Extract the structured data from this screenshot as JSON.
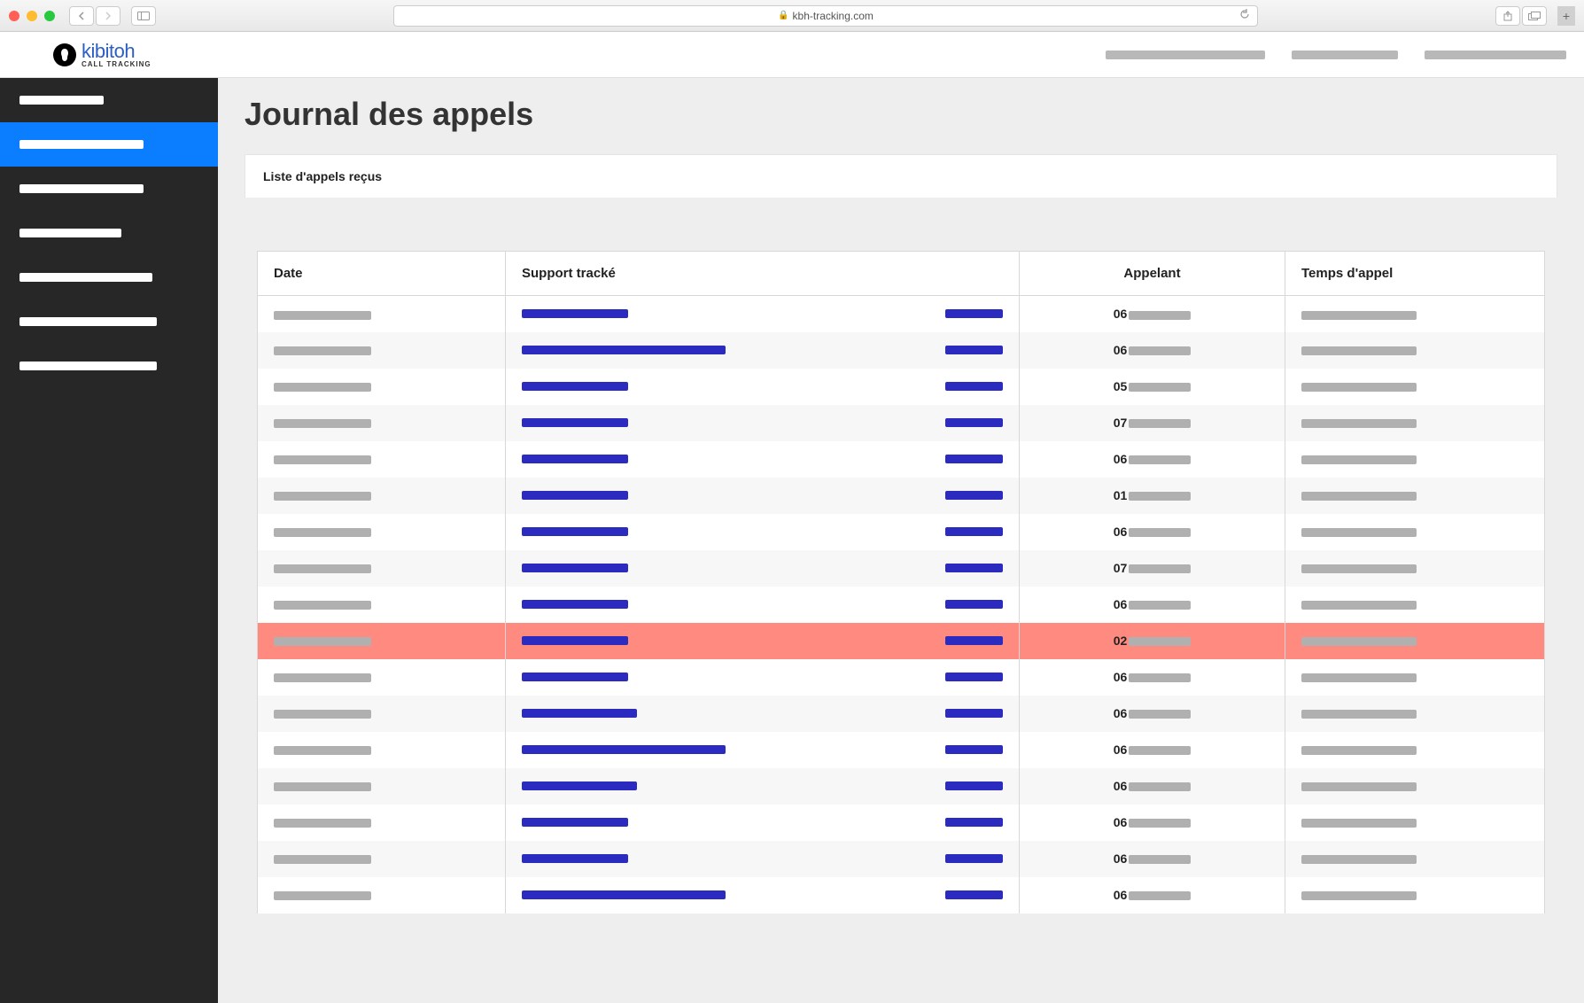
{
  "browser": {
    "url": "kbh-tracking.com"
  },
  "logo": {
    "name": "kibitoh",
    "subtitle": "CALL TRACKING"
  },
  "page": {
    "title": "Journal des appels",
    "panel_header": "Liste d'appels reçus"
  },
  "table": {
    "headers": {
      "date": "Date",
      "support": "Support tracké",
      "caller": "Appelant",
      "duration": "Temps d'appel"
    },
    "rows": [
      {
        "caller_prefix": "06",
        "support_w": 120,
        "highlight": false
      },
      {
        "caller_prefix": "06",
        "support_w": 230,
        "highlight": false
      },
      {
        "caller_prefix": "05",
        "support_w": 120,
        "highlight": false
      },
      {
        "caller_prefix": "07",
        "support_w": 120,
        "highlight": false
      },
      {
        "caller_prefix": "06",
        "support_w": 120,
        "highlight": false
      },
      {
        "caller_prefix": "01",
        "support_w": 120,
        "highlight": false
      },
      {
        "caller_prefix": "06",
        "support_w": 120,
        "highlight": false
      },
      {
        "caller_prefix": "07",
        "support_w": 120,
        "highlight": false
      },
      {
        "caller_prefix": "06",
        "support_w": 120,
        "highlight": false
      },
      {
        "caller_prefix": "02",
        "support_w": 120,
        "highlight": true
      },
      {
        "caller_prefix": "06",
        "support_w": 120,
        "highlight": false
      },
      {
        "caller_prefix": "06",
        "support_w": 130,
        "highlight": false
      },
      {
        "caller_prefix": "06",
        "support_w": 230,
        "highlight": false
      },
      {
        "caller_prefix": "06",
        "support_w": 130,
        "highlight": false
      },
      {
        "caller_prefix": "06",
        "support_w": 120,
        "highlight": false
      },
      {
        "caller_prefix": "06",
        "support_w": 120,
        "highlight": false
      },
      {
        "caller_prefix": "06",
        "support_w": 230,
        "highlight": false
      }
    ]
  }
}
